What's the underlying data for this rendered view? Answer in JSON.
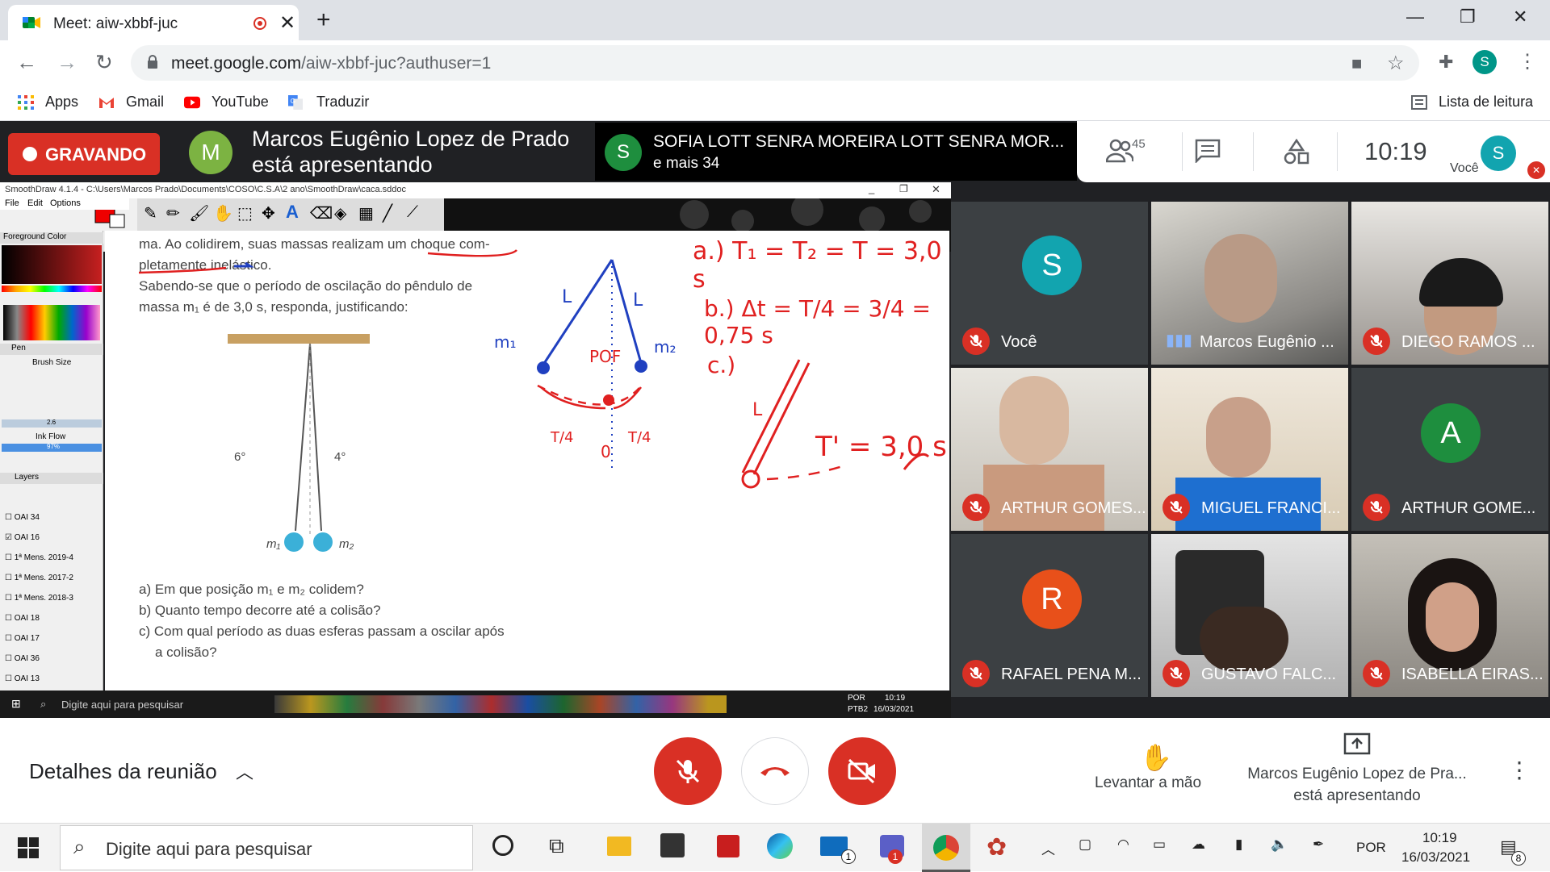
{
  "tab": {
    "title": "Meet: aiw-xbbf-juc"
  },
  "address_bar": {
    "domain": "meet.google.com",
    "path": "/aiw-xbbf-juc?authuser=1"
  },
  "profile_initial": "S",
  "bookmarks": {
    "apps": "Apps",
    "gmail": "Gmail",
    "youtube": "YouTube",
    "translate": "Traduzir",
    "reading_list": "Lista de leitura"
  },
  "meet_top": {
    "recording": "GRAVANDO",
    "presenter_initial": "M",
    "presenter_line1": "Marcos Eugênio Lopez de Prado",
    "presenter_line2": "está apresentando",
    "speaker_initial": "S",
    "speaker_name": "SOFIA LOTT SENRA MOREIRA LOTT SENRA MOR...",
    "speaker_more": "e mais 34",
    "participants_count": "45",
    "clock": "10:19",
    "you_label": "Você",
    "you_initial": "S"
  },
  "smoothdraw": {
    "title": "SmoothDraw 4.1.4 - C:\\Users\\Marcos Prado\\Documents\\COSO\\C.S.A\\2 ano\\SmoothDraw\\caca.sddoc",
    "menu": [
      "File",
      "Edit",
      "Options"
    ],
    "panel_foreground": "Foreground Color",
    "panel_pen": "Pen",
    "brush_size": "Brush Size",
    "brush_value": "2.6",
    "ink_flow": "Ink Flow",
    "ink_value": "97%",
    "layers_title": "Layers",
    "layers": [
      "OAI 34",
      "OAI 16",
      "1ª Mens. 2019-4",
      "1ª Mens. 2017-2",
      "1ª Mens. 2018-3",
      "OAI 18",
      "OAI 17",
      "OAI 36",
      "OAI 13"
    ]
  },
  "book": {
    "line1": "ma. Ao colidirem, suas massas realizam um choque com-",
    "line2": "pletamente inelástico.",
    "line3": "Sabendo-se que o período de oscilação do pêndulo de",
    "line4": "massa m₁ é de 3,0 s, responda, justificando:",
    "angle_left": "6°",
    "angle_right": "4°",
    "mass1": "m₁",
    "mass2": "m₂",
    "q_a": "a) Em que posição m₁ e m₂ colidem?",
    "q_b": "b) Quanto tempo decorre até a colisão?",
    "q_c1": "c) Com qual período as duas esferas passam a oscilar após",
    "q_c2": "a colisão?"
  },
  "handwriting": {
    "a": "a.) T₁ = T₂ = T = 3,0 s",
    "b": "b.) Δt = T/4 = 3/4 = 0,75 s",
    "c": "c.)",
    "tprime": "T' = 3,0 s",
    "L1": "L",
    "L2": "L",
    "L3": "L",
    "m1": "m₁",
    "m2": "m₂",
    "pof": "POF",
    "zero": "0",
    "t4a": "T/4",
    "t4b": "T/4"
  },
  "inner_taskbar": {
    "search": "Digite aqui para pesquisar",
    "lang": "POR",
    "layout": "PTB2",
    "time": "10:19",
    "date": "16/03/2021"
  },
  "participants": [
    {
      "name": "Você",
      "initial": "S",
      "color": "#12a4af",
      "muted": true
    },
    {
      "name": "Marcos Eugênio ...",
      "muted": false
    },
    {
      "name": "DIEGO RAMOS ...",
      "muted": true
    },
    {
      "name": "ARTHUR GOMES...",
      "muted": true
    },
    {
      "name": "MIGUEL FRANCI...",
      "muted": true
    },
    {
      "name": "ARTHUR GOME...",
      "initial": "A",
      "color": "#1e8e3e",
      "muted": true
    },
    {
      "name": "RAFAEL PENA M...",
      "initial": "R",
      "color": "#e8501a",
      "muted": true
    },
    {
      "name": "GUSTAVO FALC...",
      "muted": true
    },
    {
      "name": "ISABELLA EIRAS...",
      "muted": true
    }
  ],
  "meet_bottom": {
    "details": "Detalhes da reunião",
    "raise_hand": "Levantar a mão",
    "presenting_line1": "Marcos Eugênio Lopez de Pra...",
    "presenting_line2": "está apresentando"
  },
  "taskbar": {
    "search": "Digite aqui para pesquisar",
    "lang": "POR",
    "time": "10:19",
    "date": "16/03/2021",
    "notifications": "8",
    "mail_badge": "1",
    "app_badge": "1"
  },
  "colors": {
    "meet_dark": "#202124",
    "red": "#d93025",
    "teal": "#12a4af"
  }
}
